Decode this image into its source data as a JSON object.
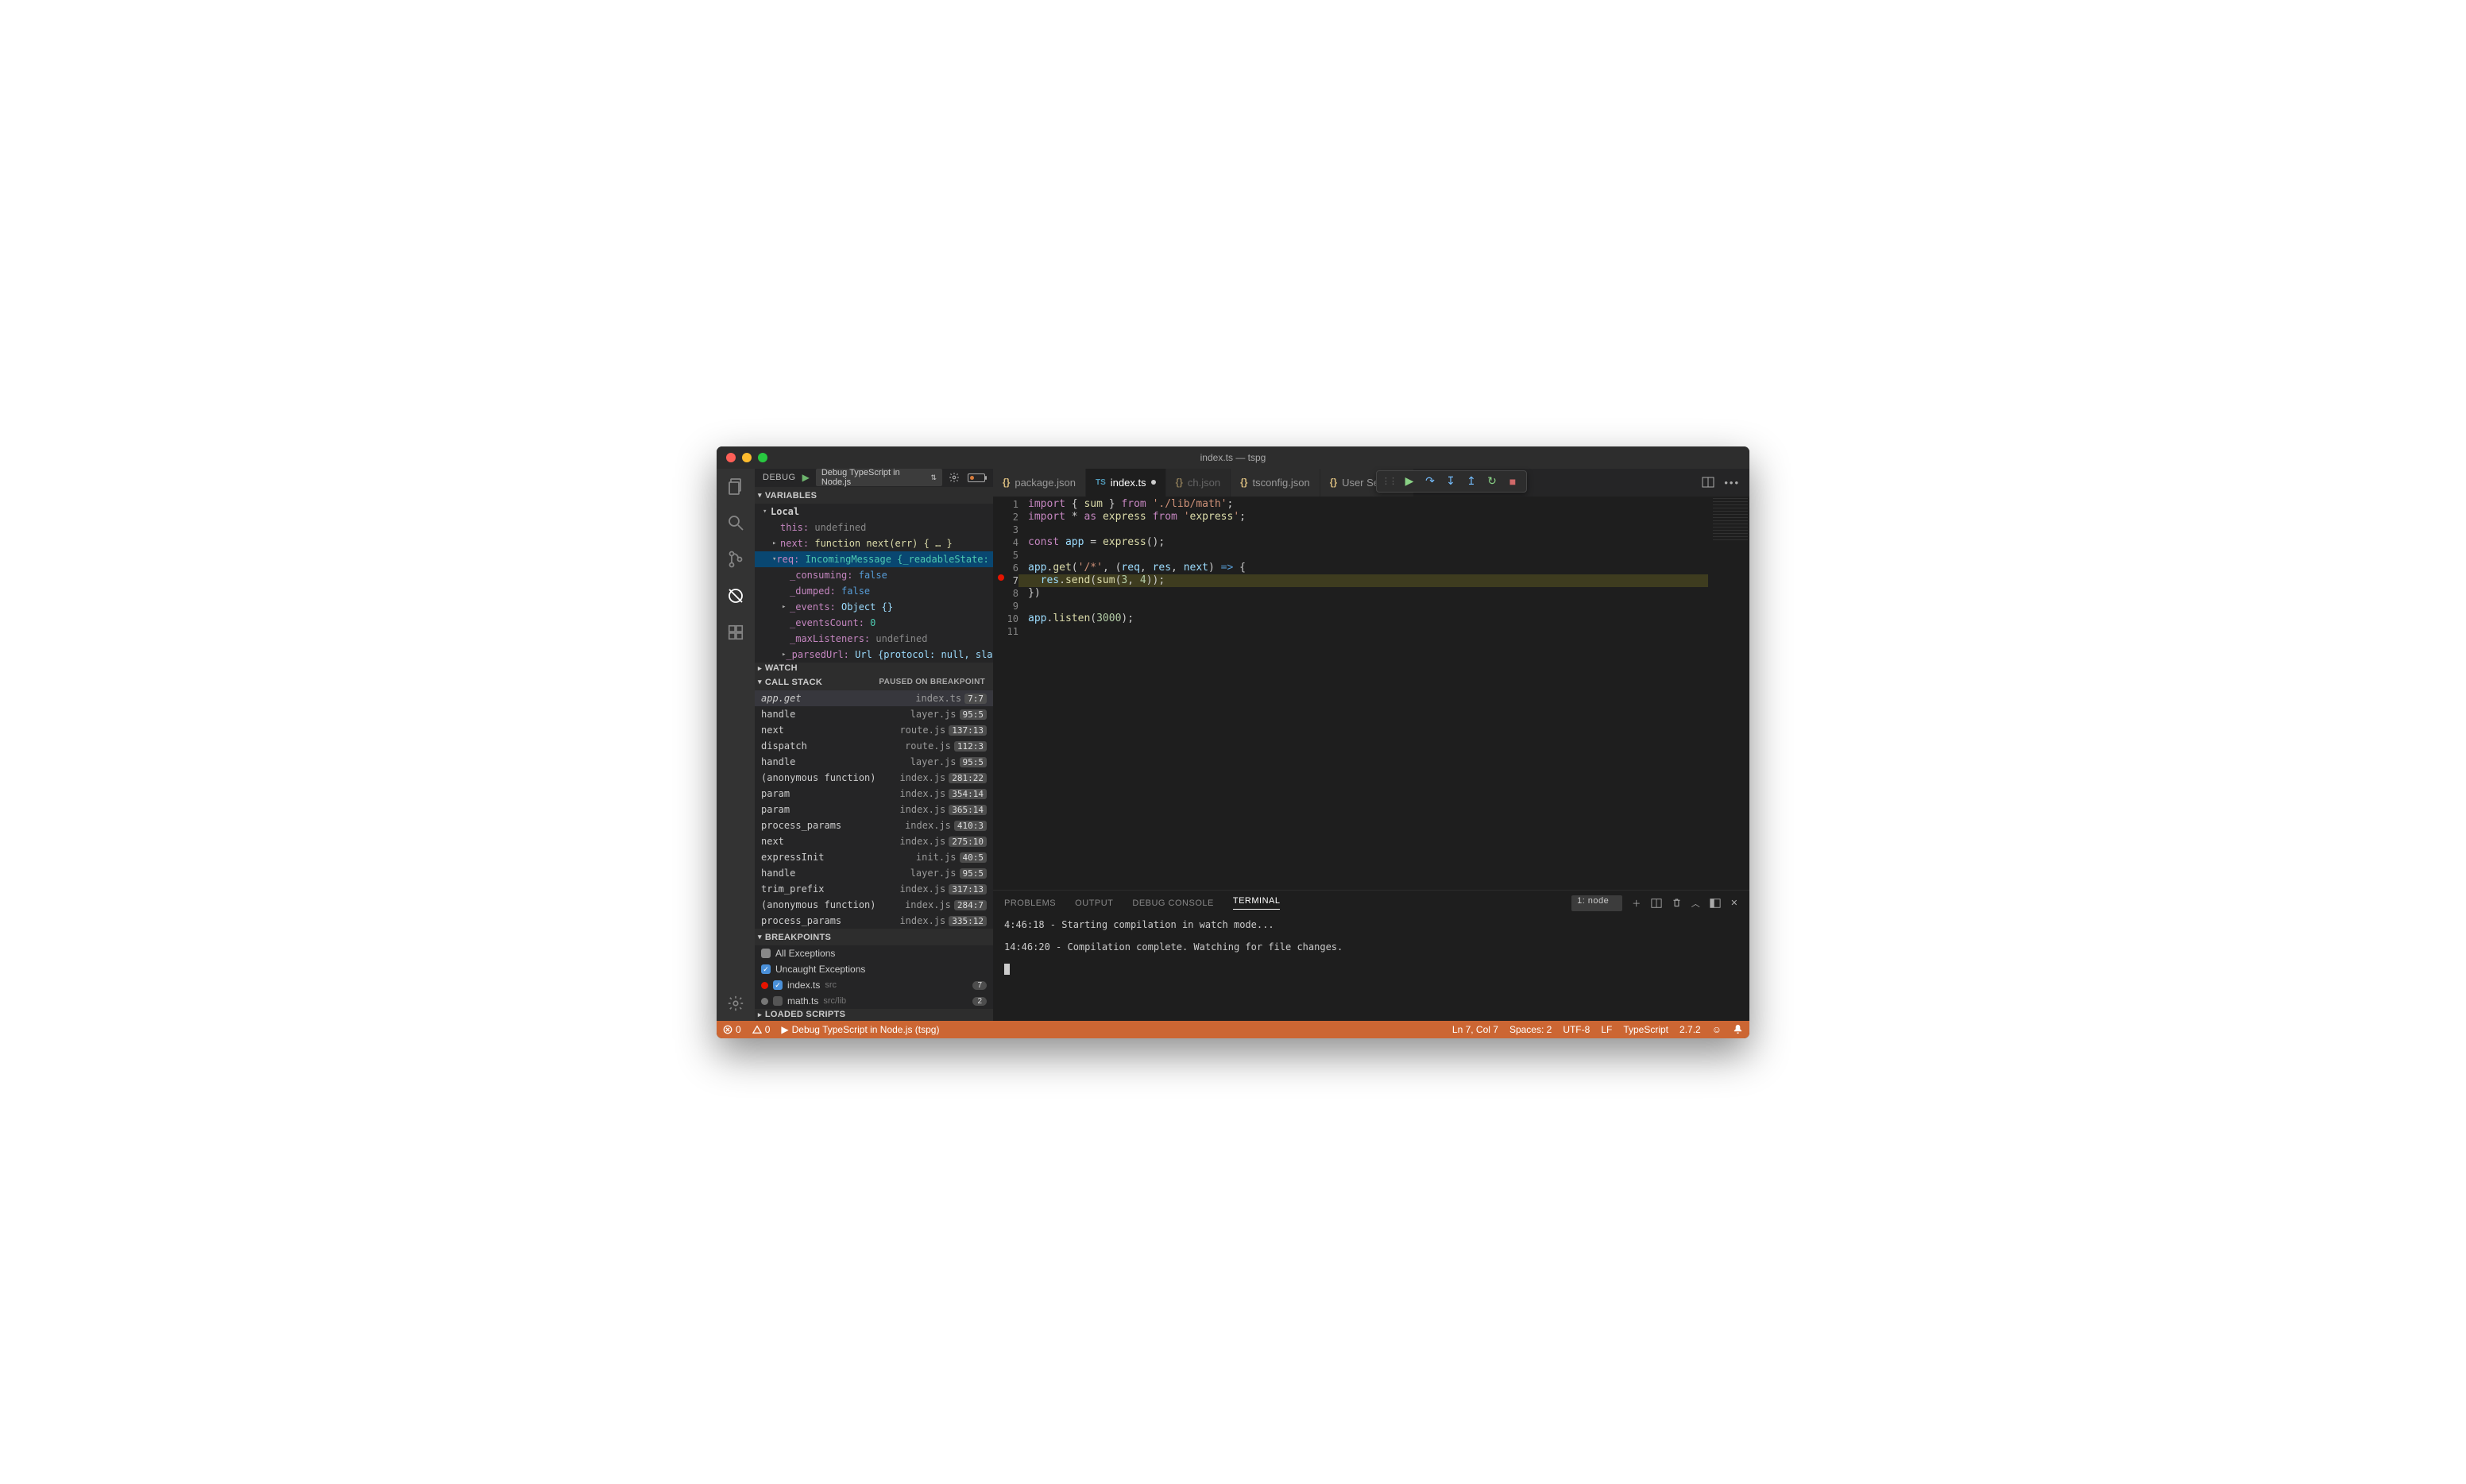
{
  "window": {
    "title": "index.ts — tspg"
  },
  "activity": {
    "items": [
      "explorer",
      "search",
      "scm",
      "debug",
      "extensions"
    ]
  },
  "debug_header": {
    "label": "DEBUG",
    "config": "Debug TypeScript in Node.js"
  },
  "variables": {
    "title": "VARIABLES",
    "scope": "Local",
    "this_label": "this:",
    "this_value": "undefined",
    "next_label": "next:",
    "next_value": "function next(err) { … }",
    "req_label": "req:",
    "req_value": "IncomingMessage {_readableState: Readabl…",
    "props": [
      {
        "k": "_consuming:",
        "v": "false",
        "vc": "k-blue"
      },
      {
        "k": "_dumped:",
        "v": "false",
        "vc": "k-blue"
      },
      {
        "k": "_events:",
        "v": "Object {}",
        "vc": "k-grey",
        "arrow": true
      },
      {
        "k": "_eventsCount:",
        "v": "0",
        "vc": "k-teal"
      },
      {
        "k": "_maxListeners:",
        "v": "undefined",
        "vc": "k-dim"
      },
      {
        "k": "_parsedUrl:",
        "v": "Url {protocol: null, slashes: n…",
        "vc": "k-grey",
        "arrow": true
      }
    ]
  },
  "watch": {
    "title": "WATCH"
  },
  "callstack": {
    "title": "CALL STACK",
    "status": "PAUSED ON BREAKPOINT",
    "frames": [
      {
        "fn": "app.get",
        "file": "index.ts",
        "pos": "7:7",
        "sel": true
      },
      {
        "fn": "handle",
        "file": "layer.js",
        "pos": "95:5"
      },
      {
        "fn": "next",
        "file": "route.js",
        "pos": "137:13"
      },
      {
        "fn": "dispatch",
        "file": "route.js",
        "pos": "112:3"
      },
      {
        "fn": "handle",
        "file": "layer.js",
        "pos": "95:5"
      },
      {
        "fn": "(anonymous function)",
        "file": "index.js",
        "pos": "281:22"
      },
      {
        "fn": "param",
        "file": "index.js",
        "pos": "354:14"
      },
      {
        "fn": "param",
        "file": "index.js",
        "pos": "365:14"
      },
      {
        "fn": "process_params",
        "file": "index.js",
        "pos": "410:3"
      },
      {
        "fn": "next",
        "file": "index.js",
        "pos": "275:10"
      },
      {
        "fn": "expressInit",
        "file": "init.js",
        "pos": "40:5"
      },
      {
        "fn": "handle",
        "file": "layer.js",
        "pos": "95:5"
      },
      {
        "fn": "trim_prefix",
        "file": "index.js",
        "pos": "317:13"
      },
      {
        "fn": "(anonymous function)",
        "file": "index.js",
        "pos": "284:7"
      },
      {
        "fn": "process_params",
        "file": "index.js",
        "pos": "335:12"
      }
    ]
  },
  "breakpoints": {
    "title": "BREAKPOINTS",
    "all_ex": "All Exceptions",
    "uncaught": "Uncaught Exceptions",
    "items": [
      {
        "file": "index.ts",
        "dir": "src",
        "count": "7",
        "checked": true,
        "active": true
      },
      {
        "file": "math.ts",
        "dir": "src/lib",
        "count": "2",
        "checked": false,
        "active": false
      }
    ]
  },
  "loaded": {
    "title": "LOADED SCRIPTS"
  },
  "tabs": [
    {
      "label": "package.json",
      "kind": "json"
    },
    {
      "label": "index.ts",
      "kind": "ts",
      "active": true,
      "dirty": true
    },
    {
      "label": "ch.json",
      "kind": "json",
      "hidden": true
    },
    {
      "label": "tsconfig.json",
      "kind": "json"
    },
    {
      "label": "User Settings",
      "kind": "json"
    }
  ],
  "code": {
    "lines": [
      "import { sum } from './lib/math';",
      "import * as express from 'express';",
      "",
      "const app = express();",
      "",
      "app.get('/*', (req, res, next) => {",
      "  res.send(sum(3, 4));",
      "})",
      "",
      "app.listen(3000);",
      ""
    ],
    "current_line": 7
  },
  "terminal": {
    "tabs": [
      "PROBLEMS",
      "OUTPUT",
      "DEBUG CONSOLE",
      "TERMINAL"
    ],
    "select": "1: node",
    "lines": [
      "4:46:18 - Starting compilation in watch mode...",
      "",
      "14:46:20 - Compilation complete. Watching for file changes.",
      ""
    ]
  },
  "status": {
    "errors": "0",
    "warnings": "0",
    "launch": "Debug TypeScript in Node.js (tspg)",
    "lncol": "Ln 7, Col 7",
    "spaces": "Spaces: 2",
    "encoding": "UTF-8",
    "eol": "LF",
    "lang": "TypeScript",
    "tsver": "2.7.2"
  }
}
